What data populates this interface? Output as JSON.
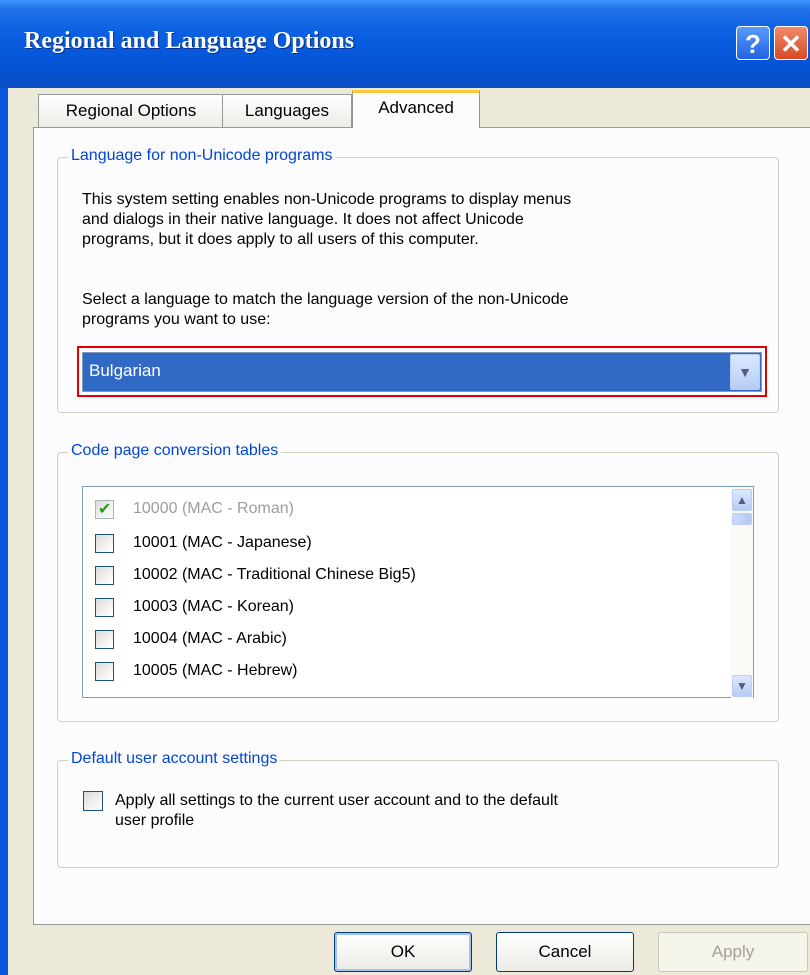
{
  "window": {
    "title": "Regional and Language Options",
    "help_glyph": "?",
    "close_glyph": "✕"
  },
  "tabs": [
    {
      "label": "Regional Options",
      "active": false
    },
    {
      "label": "Languages",
      "active": false
    },
    {
      "label": "Advanced",
      "active": true
    }
  ],
  "non_unicode": {
    "legend": "Language for non-Unicode programs",
    "description_lines": [
      "This system setting enables non-Unicode programs to display menus",
      "and dialogs in their native language. It does not affect Unicode",
      "programs, but it does apply to all users of this computer."
    ],
    "prompt_lines": [
      "Select a language to match the language version of the non-Unicode",
      "programs you want to use:"
    ],
    "selected_language": "Bulgarian"
  },
  "code_pages": {
    "legend": "Code page conversion tables",
    "items": [
      {
        "label": "10000 (MAC - Roman)",
        "checked": true,
        "disabled": true
      },
      {
        "label": "10001 (MAC - Japanese)",
        "checked": false,
        "disabled": false
      },
      {
        "label": "10002 (MAC - Traditional Chinese Big5)",
        "checked": false,
        "disabled": false
      },
      {
        "label": "10003 (MAC - Korean)",
        "checked": false,
        "disabled": false
      },
      {
        "label": "10004 (MAC - Arabic)",
        "checked": false,
        "disabled": false
      },
      {
        "label": "10005 (MAC - Hebrew)",
        "checked": false,
        "disabled": false
      }
    ]
  },
  "default_user": {
    "legend": "Default user account settings",
    "checkbox_lines": [
      "Apply all settings to the current user account and to the default",
      "user profile"
    ],
    "checked": false
  },
  "buttons": {
    "ok": "OK",
    "cancel": "Cancel",
    "apply": "Apply"
  },
  "colors": {
    "title_bar": "#0a5ee0",
    "legend_text": "#0046d5",
    "selection": "#316ac5",
    "highlight_outline": "#e30000"
  }
}
